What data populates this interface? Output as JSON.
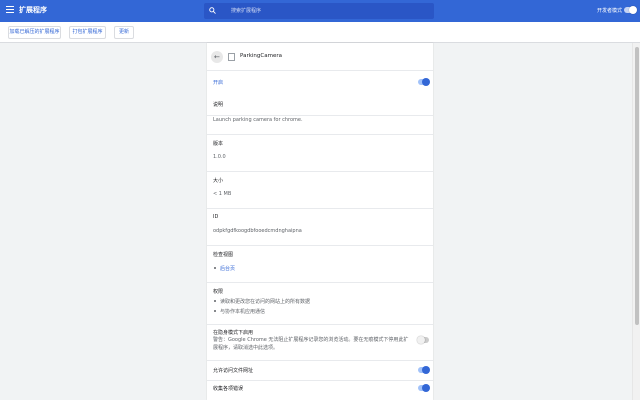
{
  "header": {
    "title": "扩展程序",
    "search_placeholder": "搜索扩展程序",
    "dev_mode_label": "开发者模式"
  },
  "toolbar": {
    "load_unpacked": "加载已解压的扩展程序",
    "pack": "打包扩展程序",
    "update": "更新"
  },
  "extension": {
    "name": "ParkingCamera",
    "enabled_label": "开启",
    "enabled": true,
    "description_label": "说明",
    "description": "Launch parking camera for chrome.",
    "version_label": "版本",
    "version": "1.0.0",
    "size_label": "大小",
    "size": "< 1 MB",
    "id_label": "ID",
    "id": "odpkfgdfkoogdbfooedcmdnghaipna",
    "views_label": "检查视图",
    "views": [
      "后台页"
    ],
    "permissions_label": "权限",
    "permissions": [
      "读取和更改您在访问的网站上的所有数据",
      "与协作本机应用通信"
    ],
    "incognito_label": "在隐身模式下启用",
    "incognito_warning": "警告：Google Chrome 无法阻止扩展程序记录您的浏览活动。要在无痕模式下停用此扩展程序，请取消选中此选项。",
    "incognito_enabled": false,
    "file_urls_label": "允许访问文件网址",
    "file_urls_enabled": true,
    "errors_label": "收集各项错误",
    "errors_enabled": true
  },
  "colors": {
    "header_bg": "#3367d6",
    "accent": "#3367d6",
    "page_bg": "#f1f3f4"
  }
}
